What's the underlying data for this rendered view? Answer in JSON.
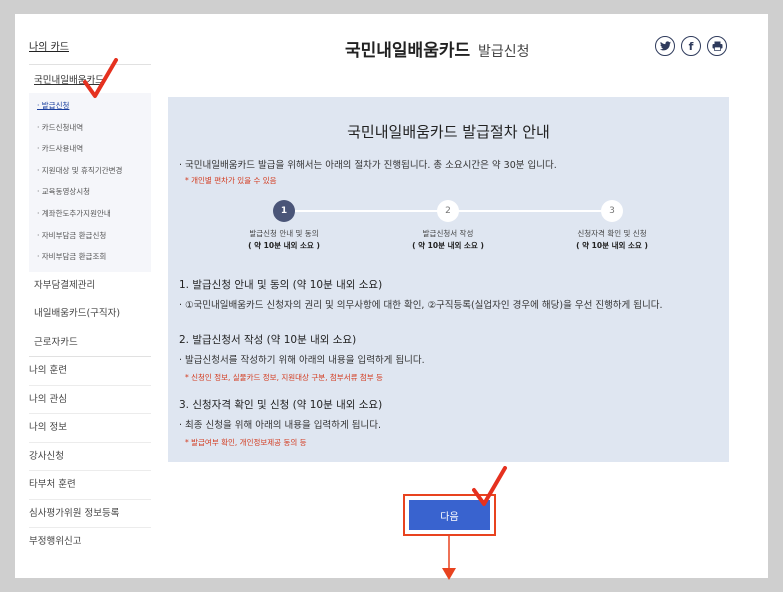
{
  "sidebar": {
    "section_title": "나의 카드",
    "card_title": "국민내일배움카드",
    "sub_items": [
      {
        "label": "· 발급신청",
        "active": true
      },
      {
        "label": "· 카드신청내역",
        "active": false
      },
      {
        "label": "· 카드사용내역",
        "active": false
      },
      {
        "label": "· 지원대상 및 휴직기간변경",
        "active": false
      },
      {
        "label": "· 교육동영상시청",
        "active": false
      },
      {
        "label": "· 계좌한도추가지원안내",
        "active": false
      },
      {
        "label": "· 자비부담금 환급신청",
        "active": false
      },
      {
        "label": "· 자비부담금 환급조회",
        "active": false
      }
    ],
    "card_items": [
      "자부담결제관리",
      "내일배움카드(구직자)",
      "근로자카드"
    ],
    "main_items": [
      "나의 훈련",
      "나의 관심",
      "나의 정보",
      "강사신청",
      "타부처 훈련",
      "심사평가위원 정보등록",
      "부정행위신고"
    ]
  },
  "header": {
    "title": "국민내일배움카드",
    "subtitle": "발급신청",
    "share_icons": [
      "twitter-icon",
      "facebook-icon",
      "print-icon"
    ]
  },
  "guide": {
    "title": "국민내일배움카드 발급절차 안내",
    "note": "· 국민내일배움카드 발급을 위해서는 아래의 절차가 진행됩니다. 총 소요시간은 약 30분 입니다.",
    "note_red": "* 개인별 편차가 있을 수 있음",
    "steps": [
      {
        "num": "1",
        "label": "발급신청 안내 및 동의",
        "time": "( 약 10분 내외 소요 )",
        "active": true
      },
      {
        "num": "2",
        "label": "발급신청서 작성",
        "time": "( 약 10분 내외 소요 )",
        "active": false
      },
      {
        "num": "3",
        "label": "신청자격 확인 및 신청",
        "time": "( 약 10분 내외 소요 )",
        "active": false
      }
    ],
    "sections": [
      {
        "heading": "1. 발급신청 안내 및 동의 (약 10분 내외 소요)",
        "text": "· ①국민내일배움카드 신청자의 권리 및 의무사항에 대한 확인, ②구직등록(실업자인 경우에 해당)을 우선 진행하게 됩니다.",
        "red": ""
      },
      {
        "heading": "2. 발급신청서 작성 (약 10분 내외 소요)",
        "text": "· 발급신청서를 작성하기 위해 아래의 내용을 입력하게 됩니다.",
        "red": "* 신청인 정보, 실물카드 정보, 지원대상 구분, 첨부서류 첨부 등"
      },
      {
        "heading": "3. 신청자격 확인 및 신청 (약 10분 내외 소요)",
        "text": "· 최종 신청을 위해 아래의 내용을 입력하게 됩니다.",
        "red": "* 발급여부 확인, 개인정보제공 동의 등"
      }
    ]
  },
  "next_button": {
    "label": "다음"
  },
  "colors": {
    "accent": "#3963cf",
    "highlight": "#e8431f",
    "check": "#e5311f",
    "panel": "#dfe6f1"
  }
}
